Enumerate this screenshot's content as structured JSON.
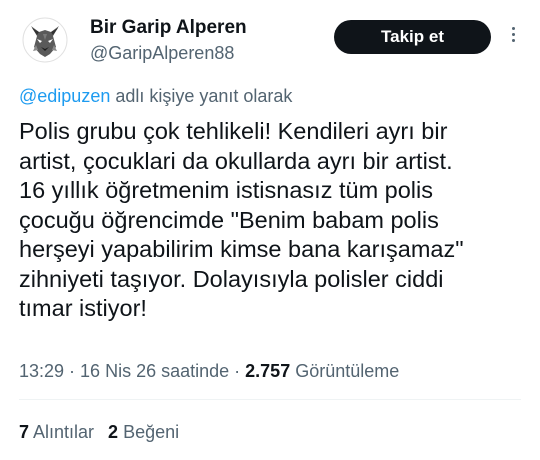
{
  "author": {
    "name": "Bir Garip Alperen",
    "handle": "@GaripAlperen88",
    "avatar_icon": "wolf-avatar-icon"
  },
  "header": {
    "follow_label": "Takip et",
    "more_icon": "more-vertical-icon"
  },
  "reply_to": {
    "mention": "@edipuzen",
    "suffix": " adlı kişiye yanıt olarak"
  },
  "tweet": {
    "text": "Polis grubu çok tehlikeli! Kendileri ayrı bir\nartist, çocuklari da okullarda ayrı bir artist.\n16 yıllık öğretmenim istisnasız tüm polis\nçocuğu öğrencimde \"Benim babam polis\nherşeyi yapabilirim kimse bana karışamaz\"\nzihniyeti taşıyor. Dolayısıyla polisler ciddi\ntımar istiyor!"
  },
  "meta": {
    "time": "13:29",
    "sep1": " · ",
    "date": "16 Nis 26 saatinde",
    "sep2": " · ",
    "views_count": "2.757",
    "views_label": " Görüntüleme"
  },
  "stats": {
    "quotes_count": "7",
    "quotes_label": " Alıntılar",
    "likes_count": "2",
    "likes_label": " Beğeni"
  },
  "colors": {
    "accent": "#1d9bf0",
    "text": "#0f1419",
    "muted": "#536471",
    "button_bg": "#0f1419"
  }
}
